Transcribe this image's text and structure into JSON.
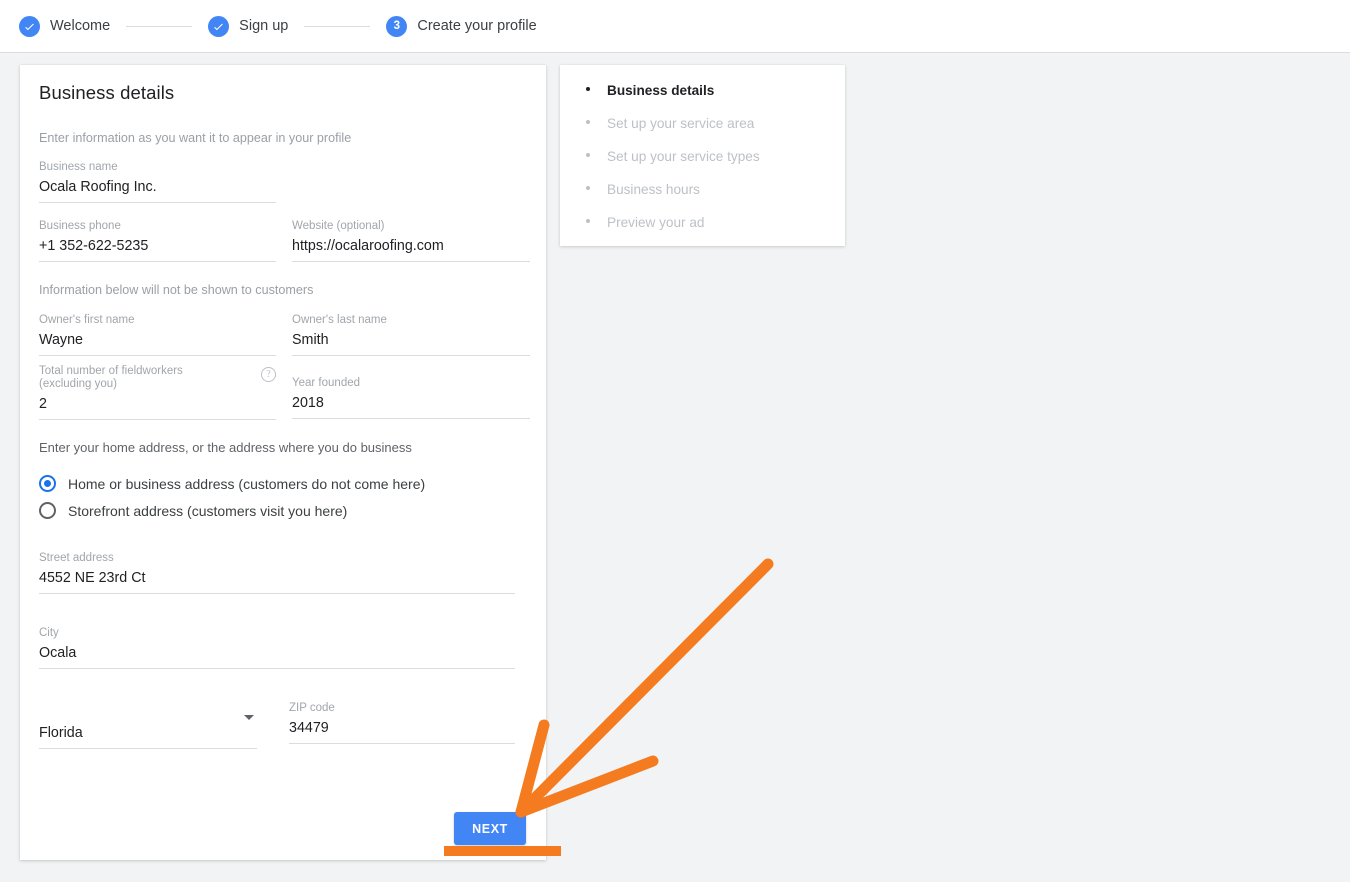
{
  "stepper": {
    "steps": [
      {
        "label": "Welcome",
        "badge": "check",
        "state": "complete"
      },
      {
        "label": "Sign up",
        "badge": "check",
        "state": "complete"
      },
      {
        "label": "Create your profile",
        "badge": "3",
        "state": "current"
      }
    ]
  },
  "form_card": {
    "title": "Business details",
    "helper_profile": "Enter information as you want it to appear in your profile",
    "helper_hidden": "Information below will not be shown to customers",
    "helper_address": "Enter your home address, or the address where you do business",
    "fields": {
      "business_name": {
        "label": "Business name",
        "value": "Ocala Roofing Inc."
      },
      "business_phone": {
        "label": "Business phone",
        "value": "+1 352-622-5235"
      },
      "website": {
        "label": "Website (optional)",
        "value": "https://ocalaroofing.com"
      },
      "owner_first_name": {
        "label": "Owner's first name",
        "value": "Wayne"
      },
      "owner_last_name": {
        "label": "Owner's last name",
        "value": "Smith"
      },
      "fieldworkers": {
        "label_line1": "Total number of fieldworkers",
        "label_line2": "(excluding you)",
        "value": "2",
        "help_icon": "?"
      },
      "year_founded": {
        "label": "Year founded",
        "value": "2018"
      },
      "street_address": {
        "label": "Street address",
        "value": "4552 NE 23rd Ct"
      },
      "city": {
        "label": "City",
        "value": "Ocala"
      },
      "state": {
        "label": "",
        "value": "Florida"
      },
      "zip_code": {
        "label": "ZIP code",
        "value": "34479"
      }
    },
    "address_type": {
      "options": [
        {
          "label": "Home or business address (customers do not come here)",
          "selected": true
        },
        {
          "label": "Storefront address (customers visit you here)",
          "selected": false
        }
      ]
    },
    "next_label": "NEXT"
  },
  "steps_card": {
    "items": [
      {
        "label": "Business details",
        "active": true
      },
      {
        "label": "Set up your service area",
        "active": false
      },
      {
        "label": "Set up your service types",
        "active": false
      },
      {
        "label": "Business hours",
        "active": false
      },
      {
        "label": "Preview your ad",
        "active": false
      }
    ]
  },
  "colors": {
    "accent_blue": "#4285f4",
    "radio_blue": "#1a73e8",
    "annotation_orange": "#f47b20",
    "page_background": "#f1f3f4",
    "card_background": "#ffffff",
    "label_gray": "#a1a6ab",
    "text_primary": "#202124"
  }
}
